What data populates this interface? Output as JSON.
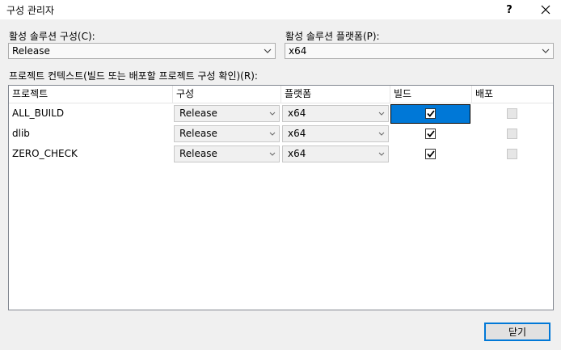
{
  "window": {
    "title": "구성 관리자",
    "help_label": "?",
    "close_icon": "close-icon"
  },
  "solution": {
    "config_label": "활성 솔루션 구성(C):",
    "config_value": "Release",
    "platform_label": "활성 솔루션 플랫폼(P):",
    "platform_value": "x64"
  },
  "grid": {
    "label": "프로젝트 컨텍스트(빌드 또는 배포할 프로젝트 구성 확인)(R):",
    "columns": [
      "프로젝트",
      "구성",
      "플랫폼",
      "빌드",
      "배포"
    ],
    "rows": [
      {
        "project": "ALL_BUILD",
        "config": "Release",
        "platform": "x64",
        "build": true,
        "deploy": false,
        "selected": true
      },
      {
        "project": "dlib",
        "config": "Release",
        "platform": "x64",
        "build": true,
        "deploy": false,
        "selected": false
      },
      {
        "project": "ZERO_CHECK",
        "config": "Release",
        "platform": "x64",
        "build": true,
        "deploy": false,
        "selected": false
      }
    ]
  },
  "footer": {
    "close_label": "닫기"
  },
  "colors": {
    "accent": "#0078d7",
    "background": "#f0f0f0"
  }
}
